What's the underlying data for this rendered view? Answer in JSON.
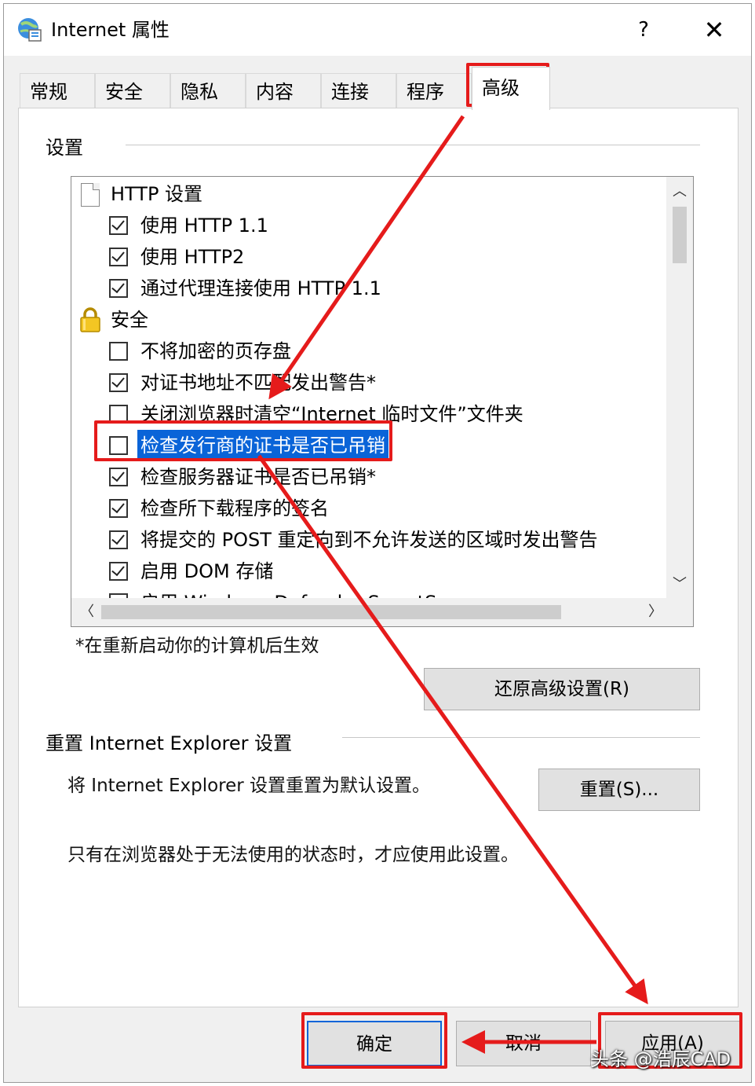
{
  "window": {
    "title": "Internet 属性",
    "help": "?",
    "close": "✕"
  },
  "tabs": [
    "常规",
    "安全",
    "隐私",
    "内容",
    "连接",
    "程序",
    "高级"
  ],
  "settings": {
    "group_label": "设置",
    "items": [
      {
        "type": "category",
        "icon": "document-icon",
        "label": "HTTP 设置"
      },
      {
        "type": "checkbox",
        "checked": true,
        "label": "使用 HTTP 1.1"
      },
      {
        "type": "checkbox",
        "checked": true,
        "label": "使用 HTTP2"
      },
      {
        "type": "checkbox",
        "checked": true,
        "label": "通过代理连接使用 HTTP 1.1"
      },
      {
        "type": "category",
        "icon": "lock-icon",
        "label": "安全"
      },
      {
        "type": "checkbox",
        "checked": false,
        "label": "不将加密的页存盘"
      },
      {
        "type": "checkbox",
        "checked": true,
        "label": "对证书地址不匹配发出警告*"
      },
      {
        "type": "checkbox",
        "checked": false,
        "label": "关闭浏览器时清空“Internet 临时文件”文件夹"
      },
      {
        "type": "checkbox",
        "checked": false,
        "label": "检查发行商的证书是否已吊销",
        "selected": true
      },
      {
        "type": "checkbox",
        "checked": true,
        "label": "检查服务器证书是否已吊销*"
      },
      {
        "type": "checkbox",
        "checked": true,
        "label": "检查所下载程序的签名"
      },
      {
        "type": "checkbox",
        "checked": true,
        "label": "将提交的 POST 重定向到不允许发送的区域时发出警告"
      },
      {
        "type": "checkbox",
        "checked": true,
        "label": "启用 DOM 存储"
      },
      {
        "type": "checkbox",
        "checked": false,
        "label": "启用 Windows Defender SmartScreen"
      }
    ],
    "restart_note": "*在重新启动你的计算机后生效",
    "restore_button": "还原高级设置(R)"
  },
  "reset": {
    "group_label": "重置 Internet Explorer 设置",
    "description": "将 Internet Explorer 设置重置为默认设置。",
    "reset_button": "重置(S)...",
    "warning": "只有在浏览器处于无法使用的状态时，才应使用此设置。"
  },
  "footer": {
    "ok": "确定",
    "cancel": "取消",
    "apply": "应用(A)"
  },
  "watermark": "头条 @浩辰CAD",
  "colors": {
    "annotation": "#e51b1b",
    "selection": "#0a64d8"
  }
}
